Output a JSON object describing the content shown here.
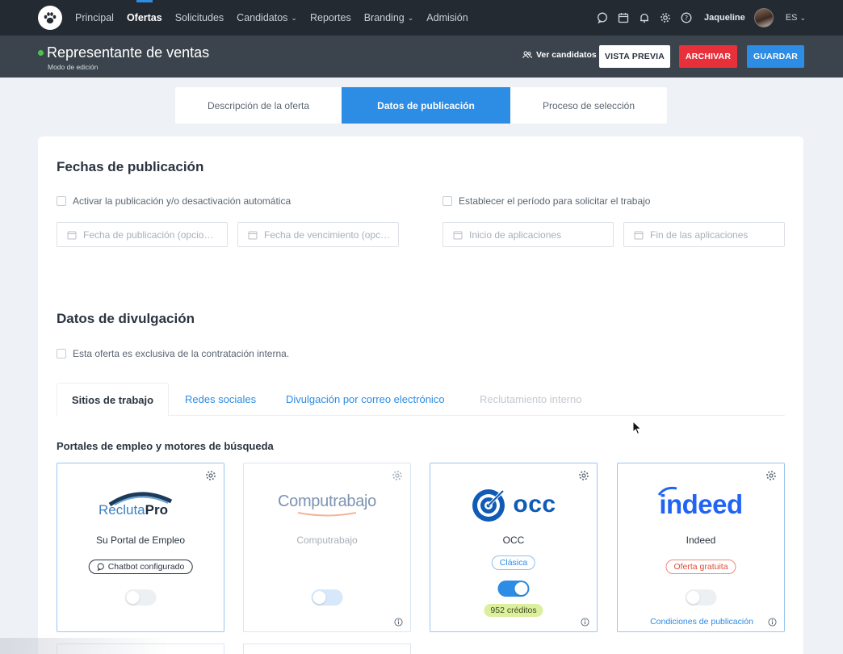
{
  "nav": {
    "items": [
      {
        "label": "Principal"
      },
      {
        "label": "Ofertas"
      },
      {
        "label": "Solicitudes"
      },
      {
        "label": "Candidatos"
      },
      {
        "label": "Reportes"
      },
      {
        "label": "Branding"
      },
      {
        "label": "Admisión"
      }
    ],
    "user_name": "Jaqueline",
    "language": "ES"
  },
  "header": {
    "job_title": "Representante de ventas",
    "mode": "Modo de edición",
    "view_candidates": "Ver candidatos",
    "preview": "VISTA PREVIA",
    "archive": "ARCHIVAR",
    "save": "GUARDAR"
  },
  "tabs": [
    {
      "label": "Descripción de la oferta"
    },
    {
      "label": "Datos de publicación"
    },
    {
      "label": "Proceso de selección"
    }
  ],
  "dates": {
    "title": "Fechas de publicación",
    "auto_toggle_label": "Activar la publicación y/o desactivación automática",
    "period_label": "Establecer el período para solicitar el trabajo",
    "pub_date_placeholder": "Fecha de publicación (opcio…",
    "exp_date_placeholder": "Fecha de vencimiento (opc…",
    "app_start_placeholder": "Inicio de aplicaciones",
    "app_end_placeholder": "Fin de las aplicaciones"
  },
  "dissemination": {
    "title": "Datos de divulgación",
    "internal_label": "Esta oferta es exclusiva de la contratación interna.",
    "subtabs": [
      {
        "label": "Sitios de trabajo"
      },
      {
        "label": "Redes sociales"
      },
      {
        "label": "Divulgación por correo electrónico"
      },
      {
        "label": "Reclutamiento interno"
      }
    ],
    "portals_heading": "Portales de empleo y motores de búsqueda",
    "portals": [
      {
        "logo_text_a": "Recluta",
        "logo_text_b": "Pro",
        "name": "Su Portal de Empleo",
        "badge": "Chatbot configurado",
        "enabled": false
      },
      {
        "logo_text": "Computrabajo",
        "name": "Computrabajo",
        "enabled": false
      },
      {
        "logo_text": "occ",
        "name": "OCC",
        "badge": "Clásica",
        "enabled": true,
        "credits": "952 créditos"
      },
      {
        "logo_text": "indeed",
        "name": "Indeed",
        "badge": "Oferta gratuita",
        "enabled": false,
        "link": "Condiciones de publicación"
      }
    ]
  },
  "colors": {
    "accent": "#2d8ce3",
    "archive": "#e8303b",
    "nav_bg": "#232a31",
    "subheader_bg": "#3b444d",
    "status_active": "#4cc44a"
  }
}
